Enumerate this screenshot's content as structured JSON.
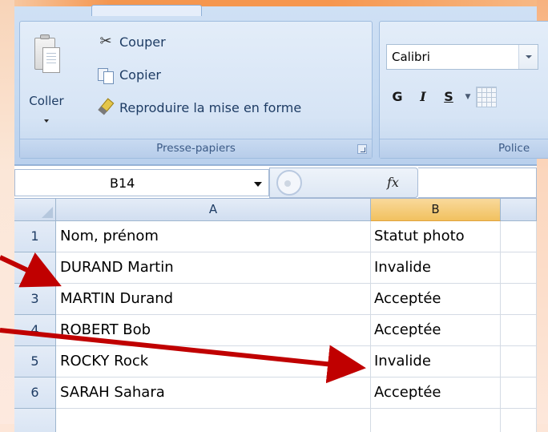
{
  "ribbon": {
    "clipboard_group": {
      "paste_label": "Coller",
      "cut_label": "Couper",
      "copy_label": "Copier",
      "format_painter_label": "Reproduire la mise en forme",
      "group_label": "Presse-papiers"
    },
    "font_group": {
      "font_name": "Calibri",
      "bold_label": "G",
      "italic_label": "I",
      "underline_label": "S",
      "group_label": "Police"
    }
  },
  "formula_bar": {
    "name_box": "B14",
    "fx_label": "fx",
    "formula_value": ""
  },
  "sheet": {
    "columns": [
      "A",
      "B"
    ],
    "rows": [
      {
        "num": "1",
        "a": "Nom, prénom",
        "b": "Statut photo"
      },
      {
        "num": "2",
        "a": "DURAND Martin",
        "b": "Invalide"
      },
      {
        "num": "3",
        "a": "MARTIN Durand",
        "b": "Acceptée"
      },
      {
        "num": "4",
        "a": "ROBERT Bob",
        "b": "Acceptée"
      },
      {
        "num": "5",
        "a": "ROCKY Rock",
        "b": "Invalide"
      },
      {
        "num": "6",
        "a": "SARAH Sahara",
        "b": "Acceptée"
      }
    ],
    "selected_column": "B"
  },
  "annotations": {
    "arrow_color": "#c00000",
    "arrow_count": 2
  },
  "colors": {
    "ribbon_blue": "#c4d9f1",
    "selected_header": "#f1c15f",
    "frame_orange": "#f38a3b"
  }
}
